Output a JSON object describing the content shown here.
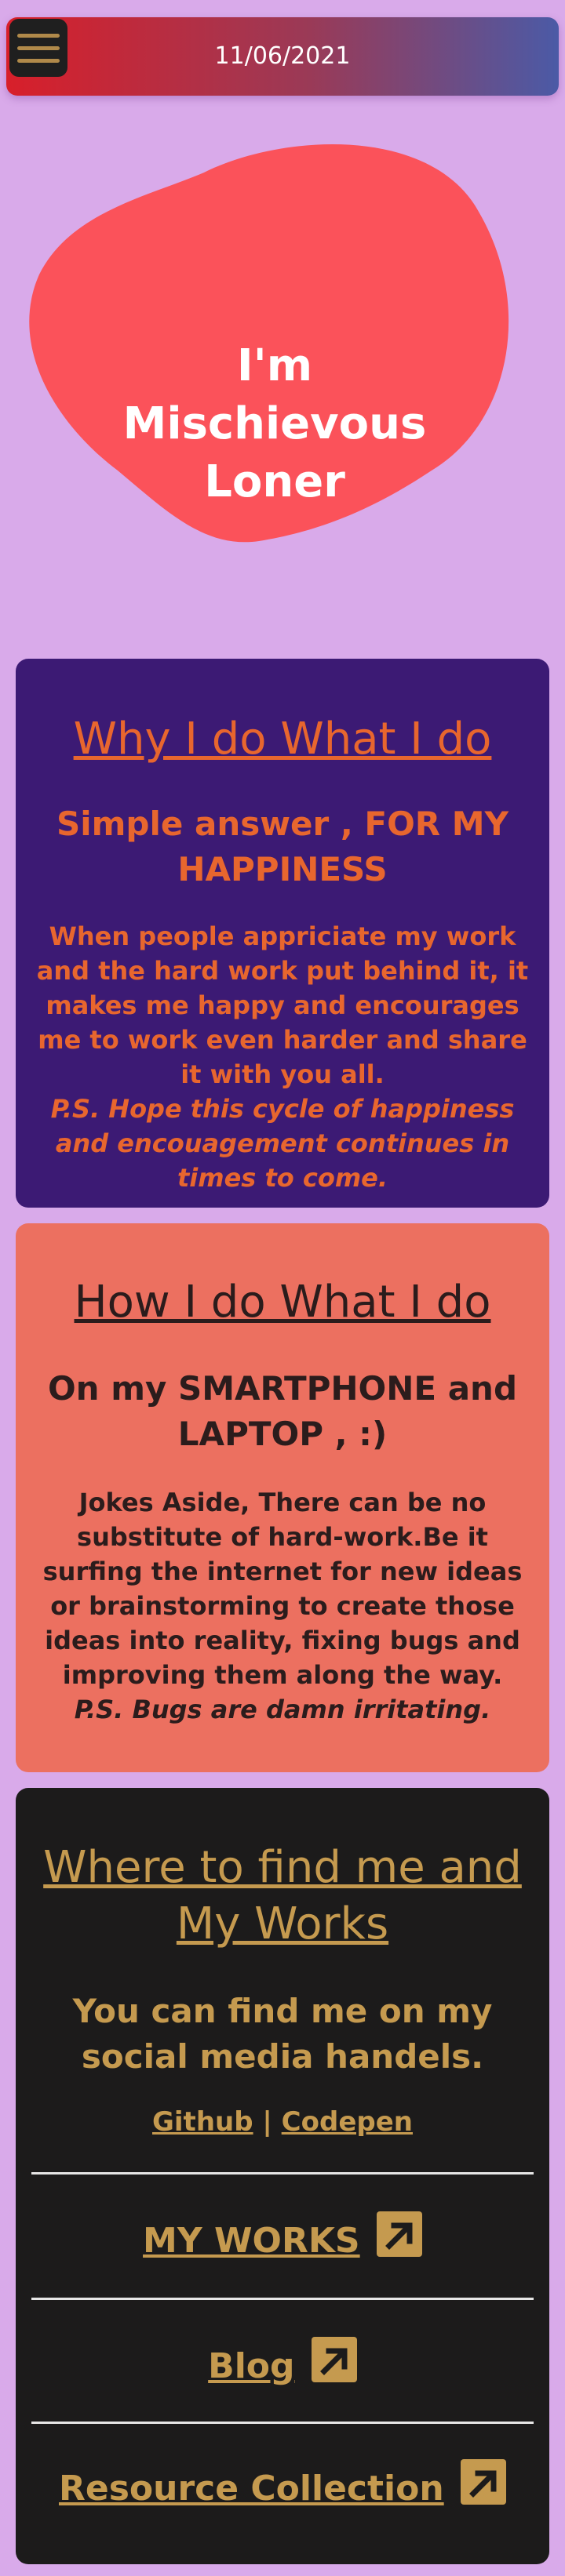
{
  "header": {
    "date": "11/06/2021",
    "menu_icon": "hamburger-menu-icon"
  },
  "hero": {
    "title": "I'm Mischievous Loner",
    "blob_color": "#fb525a"
  },
  "why": {
    "title": "Why I do What I do",
    "subtitle": "Simple answer , FOR MY HAPPINESS",
    "body": "When people appriciate my work and the hard work put behind it, it makes me happy and encourages me to work even harder and share it with you all.",
    "note": "P.S. Hope this cycle of happiness and encouagement continues in times to come."
  },
  "how": {
    "title": "How I do What I do",
    "subtitle": "On my SMARTPHONE and LAPTOP , :)",
    "body": "Jokes Aside, There can be no substitute of hard-work.Be it surfing the internet for new ideas or brainstorming to create those ideas into reality, fixing bugs and improving them along the way.",
    "note": "P.S. Bugs are damn irritating."
  },
  "where": {
    "title": "Where to find me and My Works",
    "subtitle": "You can find me on my social media handels.",
    "github": "Github",
    "separator": "|",
    "codepen": "Codepen",
    "links": [
      "MY WORKS",
      "Blog",
      "Resource Collection"
    ],
    "link_icon": "external-arrow-icon"
  },
  "colors": {
    "page_bg": "#d9aaea",
    "why_bg": "#3c1a74",
    "why_text": "#e8662e",
    "how_bg": "#ec7060",
    "where_bg": "#1c1b1b",
    "where_text": "#c59a4f"
  }
}
